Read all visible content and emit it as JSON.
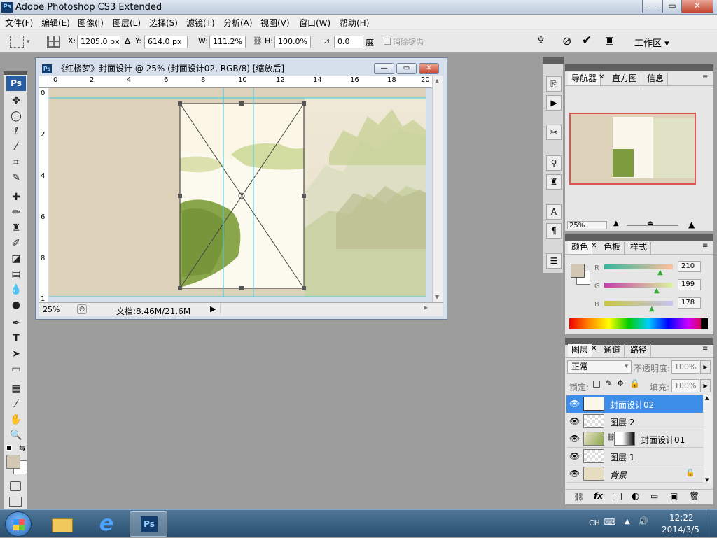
{
  "window": {
    "app_badge": "Ps",
    "title": "Adobe Photoshop CS3 Extended",
    "btn_minimize": "—",
    "btn_restore": "▭",
    "btn_close": "✕"
  },
  "menu": [
    "文件(F)",
    "编辑(E)",
    "图像(I)",
    "图层(L)",
    "选择(S)",
    "滤镜(T)",
    "分析(A)",
    "视图(V)",
    "窗口(W)",
    "帮助(H)"
  ],
  "options": {
    "x_label": "X:",
    "x_value": "1205.0 px",
    "y_label": "Y:",
    "y_value": "614.0 px",
    "w_label": "W:",
    "w_value": "111.2%",
    "h_label": "H:",
    "h_value": "100.0%",
    "angle_value": "0.0",
    "angle_unit": "度",
    "antialias_label": "消除锯齿",
    "workspace_label": "工作区 ▾"
  },
  "document": {
    "title": "《红楼梦》封面设计 @ 25% (封面设计02, RGB/8) [缩放后]",
    "zoom": "25%",
    "doc_size": "文档:8.46M/21.6M",
    "ruler_top": [
      "0",
      "2",
      "4",
      "6",
      "8",
      "10",
      "12",
      "14",
      "16",
      "18",
      "20"
    ],
    "ruler_left": [
      "0",
      "2",
      "4",
      "6",
      "8",
      "1"
    ]
  },
  "navigator": {
    "tabs": [
      "导航器",
      "直方图",
      "信息"
    ],
    "zoom": "25%"
  },
  "color_panel": {
    "tabs": [
      "颜色",
      "色板",
      "样式"
    ],
    "r_label": "R",
    "r_value": "210",
    "g_label": "G",
    "g_value": "199",
    "b_label": "B",
    "b_value": "178",
    "foreground": "#d2c7b2"
  },
  "layers_panel": {
    "tabs": [
      "图层",
      "通道",
      "路径"
    ],
    "blend_mode": "正常",
    "opacity_label": "不透明度:",
    "opacity_value": "100%",
    "lock_label": "锁定:",
    "fill_label": "填充:",
    "fill_value": "100%",
    "layers": [
      {
        "name": "封面设计02",
        "selected": true
      },
      {
        "name": "图层 2",
        "selected": false
      },
      {
        "name": "封面设计01",
        "selected": false
      },
      {
        "name": "图层 1",
        "selected": false
      },
      {
        "name": "背景",
        "selected": false
      }
    ]
  },
  "taskbar": {
    "ps_badge": "Ps",
    "lang": "CH",
    "time": "12:22",
    "date": "2014/3/5"
  }
}
